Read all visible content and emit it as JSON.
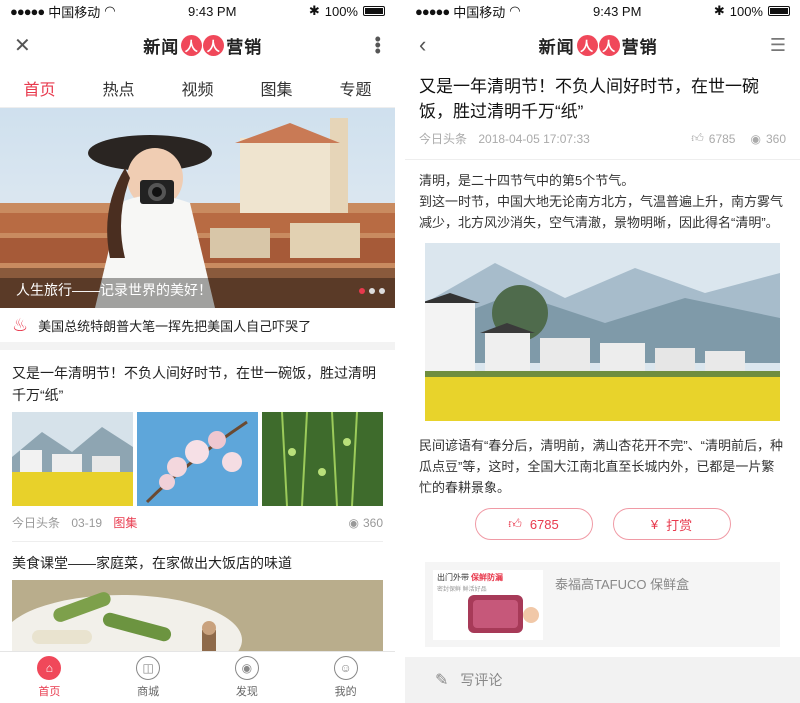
{
  "status": {
    "carrier": "中国移动",
    "time": "9:43 PM",
    "battery": "100%"
  },
  "logo": {
    "part1": "新闻",
    "highlight1": "人",
    "highlight2": "人",
    "part2": "营销"
  },
  "left": {
    "tabs": [
      "首页",
      "热点",
      "视频",
      "图集",
      "专题"
    ],
    "banner_caption": "人生旅行——记录世界的美好！",
    "hot_headline": "美国总统特朗普大笔一挥先把美国人自己吓哭了",
    "article1": {
      "title": "又是一年清明节！不负人间好时节，在世一碗饭，胜过清明千万“纸”",
      "source": "今日头条",
      "date": "03-19",
      "tag": "图集",
      "views": "360"
    },
    "article2": {
      "title": "美食课堂——家庭菜，在家做出大饭店的味道"
    },
    "bottom_nav": [
      "首页",
      "商城",
      "发现",
      "我的"
    ]
  },
  "right": {
    "title": "又是一年清明节！不负人间好时节，在世一碗饭，胜过清明千万“纸”",
    "source": "今日头条",
    "datetime": "2018-04-05 17:07:33",
    "likes": "6785",
    "views": "360",
    "para1": "清明，是二十四节气中的第5个节气。",
    "para2": "到这一时节，中国大地无论南方北方，气温普遍上升，南方雾气减少，北方风沙消失，空气清澈，景物明晰，因此得名“清明”。",
    "para3": "民间谚语有“春分后，清明前，满山杏花开不完”、“清明前后，种瓜点豆”等，这时，全国大江南北直至长城内外，已都是一片繁忙的春耕景象。",
    "like_btn": "6785",
    "reward_btn": "打赏",
    "ad_tagline": "出门外带",
    "ad_tagline_red": "保鲜防漏",
    "ad_small": "密封保鲜 鲜活好品",
    "ad_title": "泰福高TAFUCO 保鲜盒",
    "comment_placeholder": "写评论"
  },
  "colors": {
    "accent": "#e8394d"
  }
}
